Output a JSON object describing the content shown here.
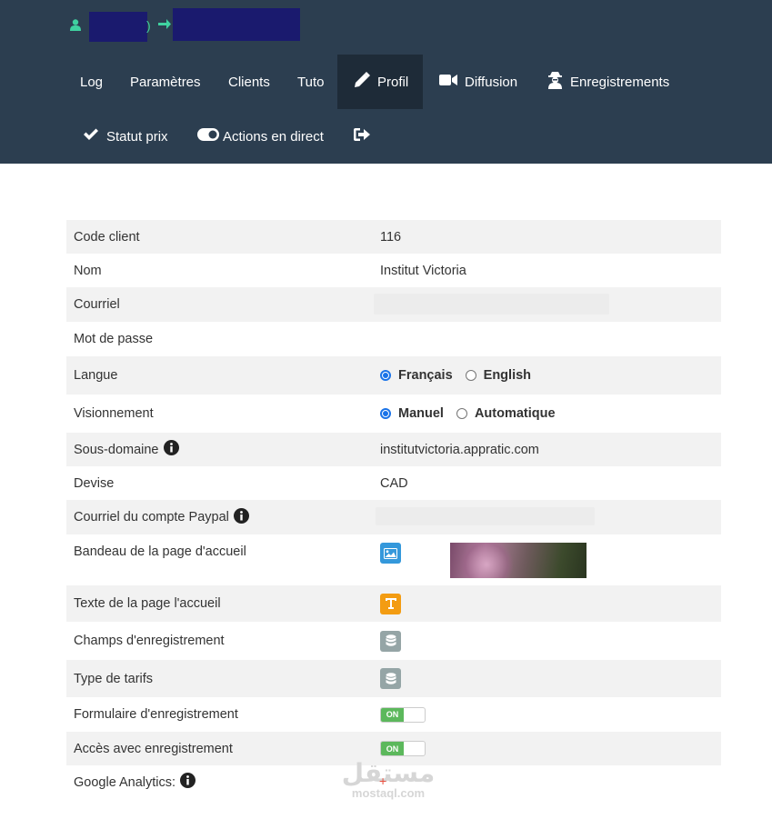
{
  "nav": {
    "items": [
      {
        "label": "Log"
      },
      {
        "label": "Paramètres"
      },
      {
        "label": "Clients"
      },
      {
        "label": "Tuto"
      },
      {
        "label": "Profil",
        "icon": "pencil-icon",
        "active": true
      },
      {
        "label": "Diffusion",
        "icon": "video-camera-icon"
      },
      {
        "label": "Enregistrements",
        "icon": "user-secret-icon"
      },
      {
        "label": "Statut prix",
        "icon": "check-icon"
      },
      {
        "label": "Actions en direct",
        "icon": "toggle-icon"
      },
      {
        "label": "",
        "icon": "logout-icon"
      }
    ],
    "user_icon": "user-icon",
    "paren": ")"
  },
  "profile": {
    "rows": [
      {
        "label": "Code client",
        "value": "116"
      },
      {
        "label": "Nom",
        "value": "Institut Victoria"
      },
      {
        "label": "Courriel",
        "value": ""
      },
      {
        "label": "Mot de passe",
        "value": ""
      },
      {
        "label": "Langue",
        "options": [
          "Français",
          "English"
        ],
        "selected": "Français"
      },
      {
        "label": "Visionnement",
        "options": [
          "Manuel",
          "Automatique"
        ],
        "selected": "Manuel"
      },
      {
        "label": "Sous-domaine",
        "value": "institutvictoria.appratic.com"
      },
      {
        "label": "Devise",
        "value": "CAD"
      },
      {
        "label": "Courriel du compte Paypal",
        "value": ""
      },
      {
        "label": "Bandeau de la page d'accueil",
        "icon": "image-icon"
      },
      {
        "label": "Texte de la page l'accueil",
        "icon": "text-icon"
      },
      {
        "label": "Champs d'enregistrement",
        "icon": "database-icon"
      },
      {
        "label": "Type de tarifs",
        "icon": "database-icon"
      },
      {
        "label": "Formulaire d'enregistrement",
        "toggle": "ON"
      },
      {
        "label": "Accès avec enregistrement",
        "toggle": "ON"
      },
      {
        "label": "Google Analytics:",
        "value": ""
      }
    ]
  },
  "watermark": {
    "arabic": "مستقل",
    "latin": "mostaql.com"
  },
  "colors": {
    "navbar": "#2c3e50",
    "active_nav": "#1e2b38",
    "accent_green": "#3fd1a0",
    "toggle_on": "#5cb85c",
    "row_stripe": "#f2f2f2"
  }
}
